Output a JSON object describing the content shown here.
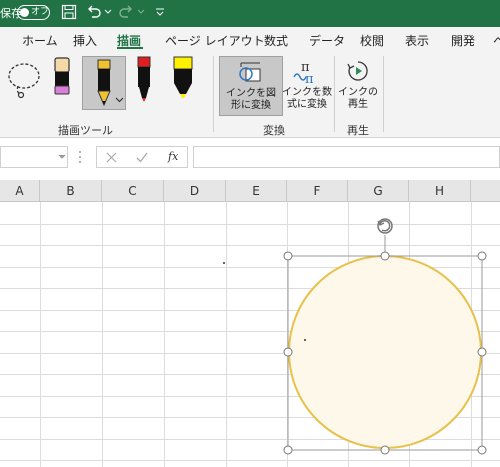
{
  "titlebar": {
    "autosave_label": "保存",
    "autosave_state": "オフ"
  },
  "tabs": [
    {
      "label": "ホーム"
    },
    {
      "label": "挿入"
    },
    {
      "label": "描画",
      "active": true
    },
    {
      "label": "ページ レイアウト"
    },
    {
      "label": "数式"
    },
    {
      "label": "データ"
    },
    {
      "label": "校閲"
    },
    {
      "label": "表示"
    },
    {
      "label": "開発"
    },
    {
      "label": "ヘ"
    }
  ],
  "ribbon": {
    "groups": [
      {
        "label": "描画ツール"
      },
      {
        "label": "変換"
      },
      {
        "label": "再生"
      }
    ],
    "buttons": {
      "ink_to_shape": "インクを図形に変換",
      "ink_to_math": "インクを数式に変換",
      "ink_replay": "インクの再生"
    }
  },
  "formula_bar": {
    "fx_label": "fx",
    "value": ""
  },
  "columns": [
    "A",
    "B",
    "C",
    "D",
    "E",
    "F",
    "G",
    "H"
  ],
  "colors": {
    "excel_green": "#217346",
    "shape_stroke": "#e8c14a",
    "shape_fill": "#fdf8ea"
  }
}
